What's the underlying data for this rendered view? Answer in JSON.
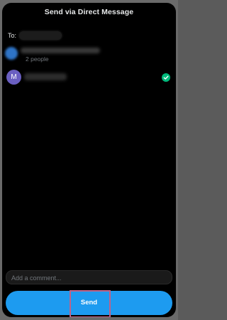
{
  "dialog": {
    "title": "Send via Direct Message"
  },
  "to": {
    "label": "To:"
  },
  "recipients": {
    "group": {
      "subtitle": "2 people",
      "avatar_color": "#2e74c7"
    },
    "user": {
      "initial": "M",
      "avatar_color": "#6a5fc1",
      "selected": true,
      "check_icon": "check-circle-icon"
    }
  },
  "comment": {
    "placeholder": "Add a comment...",
    "value": ""
  },
  "send": {
    "label": "Send",
    "color": "#1d9bf0"
  },
  "accents": {
    "check_color": "#00ba7c",
    "highlight_color": "#c06287"
  }
}
